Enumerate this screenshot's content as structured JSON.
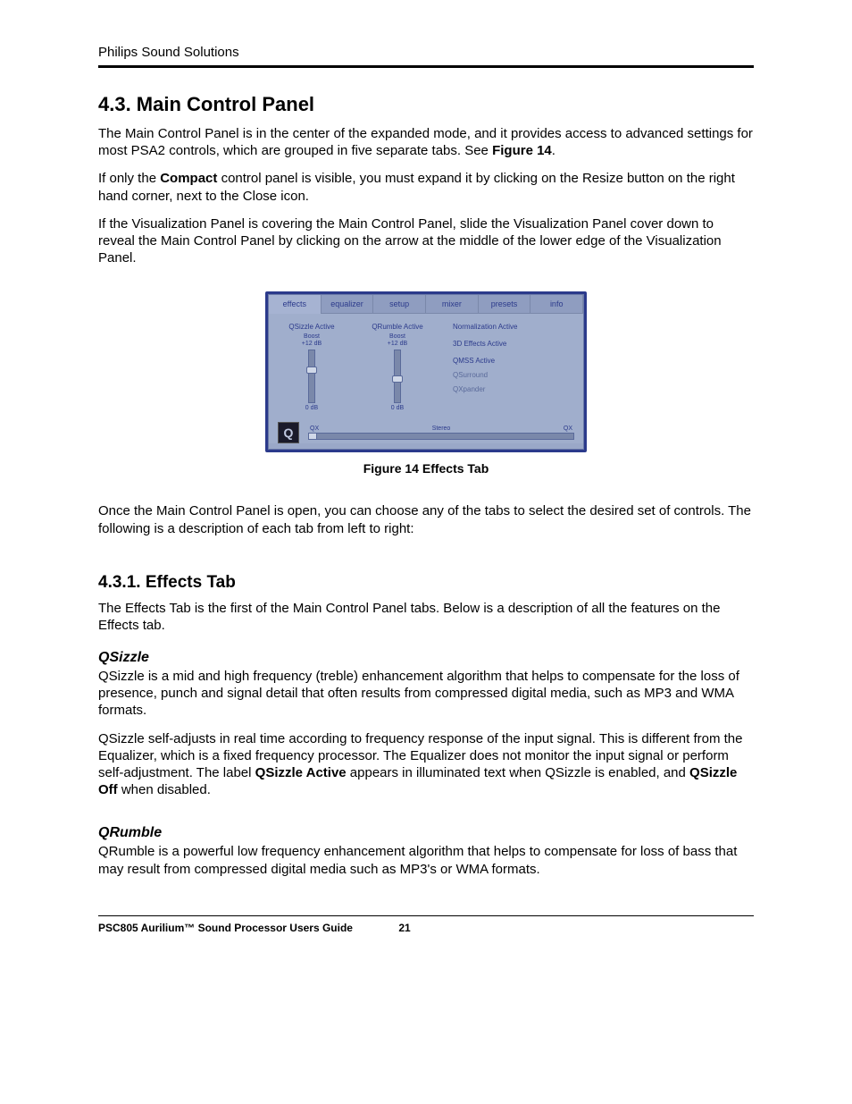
{
  "header": {
    "company": "Philips Sound Solutions"
  },
  "sections": {
    "main_control_panel": {
      "number_title": "4.3.   Main Control Panel",
      "p1_a": "The Main Control Panel is in the center of the expanded mode, and it provides access to advanced settings for most PSA2 controls, which are grouped in five separate tabs. See ",
      "p1_b": "Figure 14",
      "p1_c": ".",
      "p2_a": "If only the ",
      "p2_b": "Compact",
      "p2_c": " control panel is visible, you must expand it by clicking on the Resize button on the right hand corner, next to the Close icon.",
      "p3": "If the Visualization Panel is covering the Main Control Panel, slide the Visualization Panel cover down to reveal the Main Control Panel by clicking on the arrow at the middle of the lower edge of the Visualization Panel.",
      "p4": "Once the Main Control Panel is open, you can choose any of the tabs to select the desired set of controls. The following is a description of each tab from left to right:"
    },
    "effects_tab": {
      "number_title": "4.3.1.   Effects Tab",
      "p1": "The Effects Tab is the first of the Main Control Panel tabs. Below is a description of all the features on the Effects tab."
    },
    "qsizzle": {
      "title": "QSizzle",
      "p1": "QSizzle is a mid and high frequency (treble) enhancement algorithm that helps to compensate for the loss of presence, punch and signal detail that often results from compressed digital media, such as MP3 and WMA formats.",
      "p2_a": "QSizzle self-adjusts in real time according to frequency response of the input signal. This is different from the Equalizer, which is a fixed frequency processor. The Equalizer does not monitor the input signal or perform self-adjustment. The label ",
      "p2_b": "QSizzle Active",
      "p2_c": " appears in illuminated text when QSizzle is enabled, and ",
      "p2_d": "QSizzle Off",
      "p2_e": " when disabled."
    },
    "qrumble": {
      "title": "QRumble",
      "p1": "QRumble is a powerful low frequency enhancement algorithm that helps to compensate for loss of bass that may result from compressed digital media such as MP3's or WMA formats."
    }
  },
  "figure": {
    "caption": "Figure 14 Effects Tab",
    "tabs": [
      "effects",
      "equalizer",
      "setup",
      "mixer",
      "presets",
      "info"
    ],
    "qsizzle": {
      "title": "QSizzle Active",
      "boost": "Boost",
      "max_db": "+12 dB",
      "zero": "0 dB"
    },
    "qrumble": {
      "title": "QRumble Active",
      "boost": "Boost",
      "max_db": "+12 dB",
      "zero": "0 dB"
    },
    "right": {
      "normalization": "Normalization Active",
      "fx3d": "3D Effects Active",
      "qmss": "QMSS Active",
      "qsurround": "QSurround",
      "qxpander": "QXpander"
    },
    "footer": {
      "logo": "Q",
      "qx_left": "QX",
      "stereo": "Stereo",
      "qx_right": "QX"
    }
  },
  "footer": {
    "doc_title": "PSC805 Aurilium™ Sound Processor Users Guide",
    "page": "21"
  }
}
